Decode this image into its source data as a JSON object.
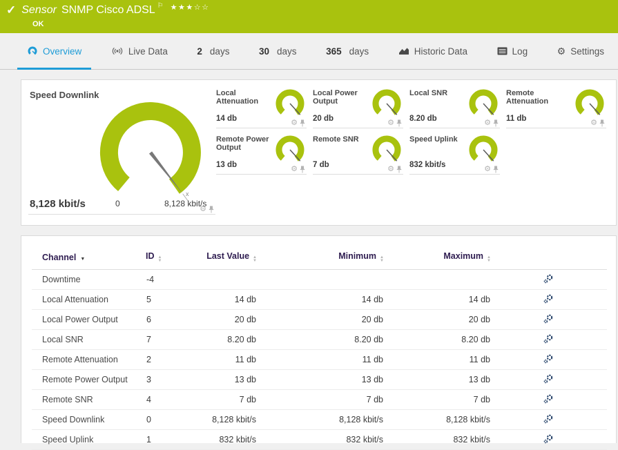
{
  "colors": {
    "brand_green": "#a9c20e",
    "tab_active_blue": "#1e9cd7"
  },
  "header": {
    "check_icon": "✓",
    "kind": "Sensor",
    "title": "SNMP Cisco ADSL",
    "flag_icon": "⚐",
    "stars": "★★★☆☆",
    "status": "OK"
  },
  "tabs": {
    "overview": {
      "label": "Overview"
    },
    "live_data": {
      "label": "Live Data"
    },
    "days2": {
      "num": "2",
      "unit": "days"
    },
    "days30": {
      "num": "30",
      "unit": "days"
    },
    "days365": {
      "num": "365",
      "unit": "days"
    },
    "historic": {
      "label": "Historic Data"
    },
    "log": {
      "label": "Log"
    },
    "settings": {
      "label": "Settings",
      "gear_icon": "⚙"
    }
  },
  "gauges": {
    "primary": {
      "title": "Speed Downlink",
      "value": "8,128 kbit/s",
      "scale_min": "0",
      "scale_max": "8,128 kbit/s",
      "needle_marker": "x",
      "gear_icon": "⚙"
    },
    "small": [
      {
        "title": "Local Attenuation",
        "value": "14 db",
        "gear_icon": "⚙"
      },
      {
        "title": "Local Power Output",
        "value": "20 db",
        "gear_icon": "⚙"
      },
      {
        "title": "Local SNR",
        "value": "8.20 db",
        "gear_icon": "⚙"
      },
      {
        "title": "Remote Attenuation",
        "value": "11 db",
        "gear_icon": "⚙"
      },
      {
        "title": "Remote Power Output",
        "value": "13 db",
        "gear_icon": "⚙"
      },
      {
        "title": "Remote SNR",
        "value": "7 db",
        "gear_icon": "⚙"
      },
      {
        "title": "Speed Uplink",
        "value": "832 kbit/s",
        "gear_icon": "⚙"
      }
    ]
  },
  "table": {
    "headers": {
      "channel": "Channel",
      "id": "ID",
      "last": "Last Value",
      "min": "Minimum",
      "max": "Maximum"
    },
    "rows": [
      {
        "channel": "Downtime",
        "id": "-4",
        "last": "",
        "min": "",
        "max": ""
      },
      {
        "channel": "Local Attenuation",
        "id": "5",
        "last": "14 db",
        "min": "14 db",
        "max": "14 db"
      },
      {
        "channel": "Local Power Output",
        "id": "6",
        "last": "20 db",
        "min": "20 db",
        "max": "20 db"
      },
      {
        "channel": "Local SNR",
        "id": "7",
        "last": "8.20 db",
        "min": "8.20 db",
        "max": "8.20 db"
      },
      {
        "channel": "Remote Attenuation",
        "id": "2",
        "last": "11 db",
        "min": "11 db",
        "max": "11 db"
      },
      {
        "channel": "Remote Power Output",
        "id": "3",
        "last": "13 db",
        "min": "13 db",
        "max": "13 db"
      },
      {
        "channel": "Remote SNR",
        "id": "4",
        "last": "7 db",
        "min": "7 db",
        "max": "7 db"
      },
      {
        "channel": "Speed Downlink",
        "id": "0",
        "last": "8,128 kbit/s",
        "min": "8,128 kbit/s",
        "max": "8,128 kbit/s"
      },
      {
        "channel": "Speed Uplink",
        "id": "1",
        "last": "832 kbit/s",
        "min": "832 kbit/s",
        "max": "832 kbit/s"
      }
    ]
  }
}
